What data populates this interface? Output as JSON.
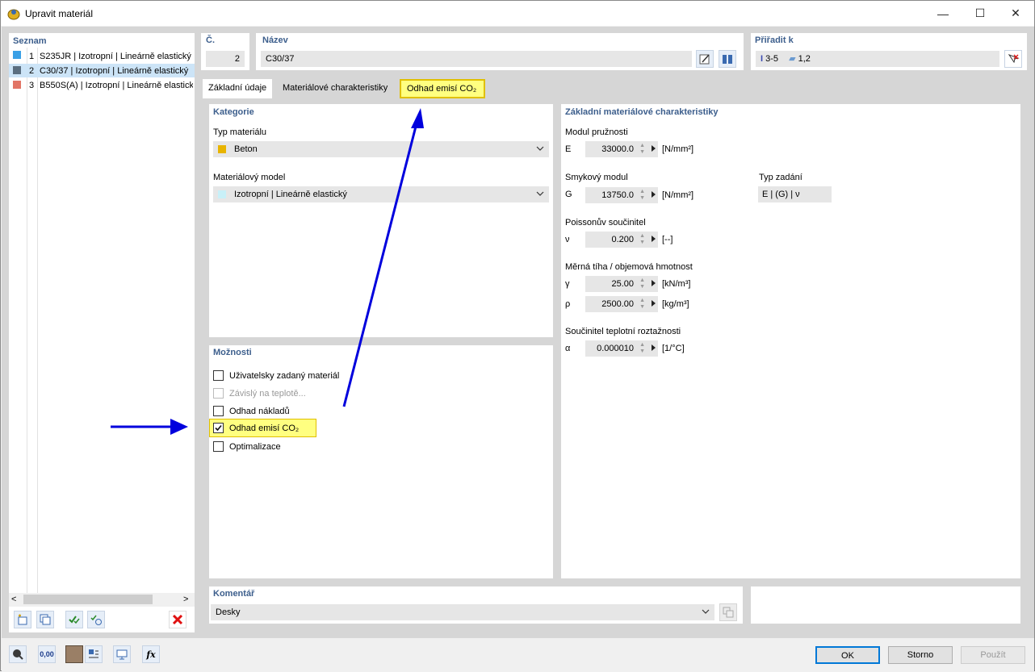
{
  "window": {
    "title": "Upravit materiál",
    "minimize": "—",
    "maximize": "☐",
    "close": "✕"
  },
  "list": {
    "header": "Seznam",
    "items": [
      {
        "num": "1",
        "label": "S235JR | Izotropní | Lineárně elastický",
        "color": "#3aa0e6"
      },
      {
        "num": "2",
        "label": "C30/37 | Izotropní | Lineárně elastický",
        "color": "#5a6e80"
      },
      {
        "num": "3",
        "label": "B550S(A) | Izotropní | Lineárně elastický",
        "color": "#e27566"
      }
    ],
    "scroll_left": "<",
    "scroll_right": ">"
  },
  "header": {
    "no_label": "Č.",
    "no_value": "2",
    "name_label": "Název",
    "name_value": "C30/37",
    "assign_label": "Přiřadit k",
    "assign_members": "3-5",
    "assign_surfaces": "1,2"
  },
  "tabs": [
    "Základní údaje",
    "Materiálové charakteristiky",
    "Odhad emisí CO₂"
  ],
  "category": {
    "title": "Kategorie",
    "type_label": "Typ materiálu",
    "type_value": "Beton",
    "type_color": "#e8b400",
    "model_label": "Materiálový model",
    "model_value": "Izotropní | Lineárně elastický",
    "model_color": "#c8f0f8"
  },
  "options": {
    "title": "Možnosti",
    "items": [
      {
        "label": "Uživatelsky zadaný materiál",
        "checked": false,
        "disabled": false
      },
      {
        "label": "Závislý na teplotě...",
        "checked": false,
        "disabled": true
      },
      {
        "label": "Odhad nákladů",
        "checked": false,
        "disabled": false
      },
      {
        "label": "Odhad emisí CO₂",
        "checked": true,
        "disabled": false
      },
      {
        "label": "Optimalizace",
        "checked": false,
        "disabled": false
      }
    ]
  },
  "props": {
    "title": "Základní materiálové charakteristiky",
    "e_title": "Modul pružnosti",
    "e_sym": "E",
    "e_val": "33000.0",
    "e_unit": "[N/mm²]",
    "g_title": "Smykový modul",
    "g_sym": "G",
    "g_val": "13750.0",
    "g_unit": "[N/mm²]",
    "input_type_label": "Typ zadání",
    "input_type_value": "E | (G) | ν",
    "nu_title": "Poissonův součinitel",
    "nu_sym": "ν",
    "nu_val": "0.200",
    "nu_unit": "[--]",
    "w_title": "Měrná tíha / objemová hmotnost",
    "gamma_sym": "γ",
    "gamma_val": "25.00",
    "gamma_unit": "[kN/m³]",
    "rho_sym": "ρ",
    "rho_val": "2500.00",
    "rho_unit": "[kg/m³]",
    "a_title": "Součinitel teplotní roztažnosti",
    "a_sym": "α",
    "a_val": "0.000010",
    "a_unit": "[1/°C]"
  },
  "comment": {
    "label": "Komentář",
    "value": "Desky"
  },
  "buttons": {
    "ok": "OK",
    "cancel": "Storno",
    "apply": "Použít"
  },
  "colors": {
    "highlight": "#ffff80",
    "highlight_border": "#e0c000",
    "arrow": "#0000dd",
    "group_title": "#3c5e8c"
  }
}
